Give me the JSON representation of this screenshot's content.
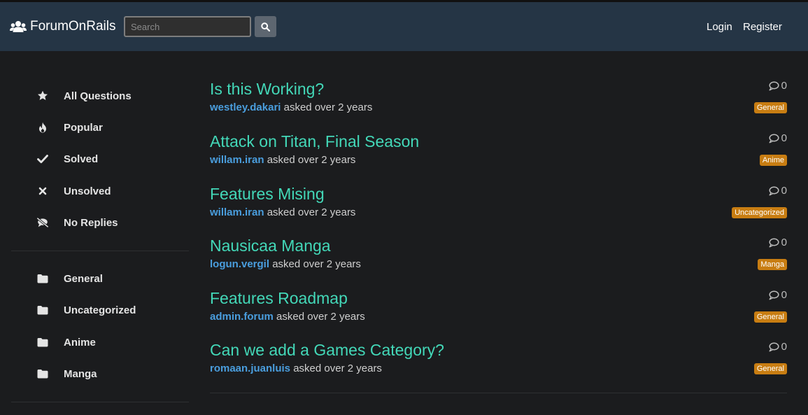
{
  "app": {
    "brand": "ForumOnRails"
  },
  "search": {
    "placeholder": "Search"
  },
  "nav": {
    "login": "Login",
    "register": "Register"
  },
  "sidebar": {
    "filters": [
      {
        "label": "All Questions",
        "icon": "star-icon"
      },
      {
        "label": "Popular",
        "icon": "fire-icon"
      },
      {
        "label": "Solved",
        "icon": "check-icon"
      },
      {
        "label": "Unsolved",
        "icon": "times-icon"
      },
      {
        "label": "No Replies",
        "icon": "comment-slash-icon"
      }
    ],
    "categories": [
      {
        "label": "General",
        "icon": "folder-icon"
      },
      {
        "label": "Uncategorized",
        "icon": "folder-icon"
      },
      {
        "label": "Anime",
        "icon": "folder-icon"
      },
      {
        "label": "Manga",
        "icon": "folder-icon"
      }
    ]
  },
  "questions": [
    {
      "title": "Is this Working?",
      "user": "westley.dakari",
      "meta": "asked over 2 years",
      "replies": "0",
      "tag": "General"
    },
    {
      "title": "Attack on Titan, Final Season",
      "user": "willam.iran",
      "meta": "asked over 2 years",
      "replies": "0",
      "tag": "Anime"
    },
    {
      "title": "Features Mising",
      "user": "willam.iran",
      "meta": "asked over 2 years",
      "replies": "0",
      "tag": "Uncategorized"
    },
    {
      "title": "Nausicaa Manga",
      "user": "logun.vergil",
      "meta": "asked over 2 years",
      "replies": "0",
      "tag": "Manga"
    },
    {
      "title": "Features Roadmap",
      "user": "admin.forum",
      "meta": "asked over 2 years",
      "replies": "0",
      "tag": "General"
    },
    {
      "title": "Can we add a Games Category?",
      "user": "romaan.juanluis",
      "meta": "asked over 2 years",
      "replies": "0",
      "tag": "General"
    }
  ],
  "colors": {
    "navbar": "#253545",
    "background": "#1b1c1e",
    "title": "#43d8b8",
    "user": "#4a9ede",
    "tag": "#c87d12"
  }
}
